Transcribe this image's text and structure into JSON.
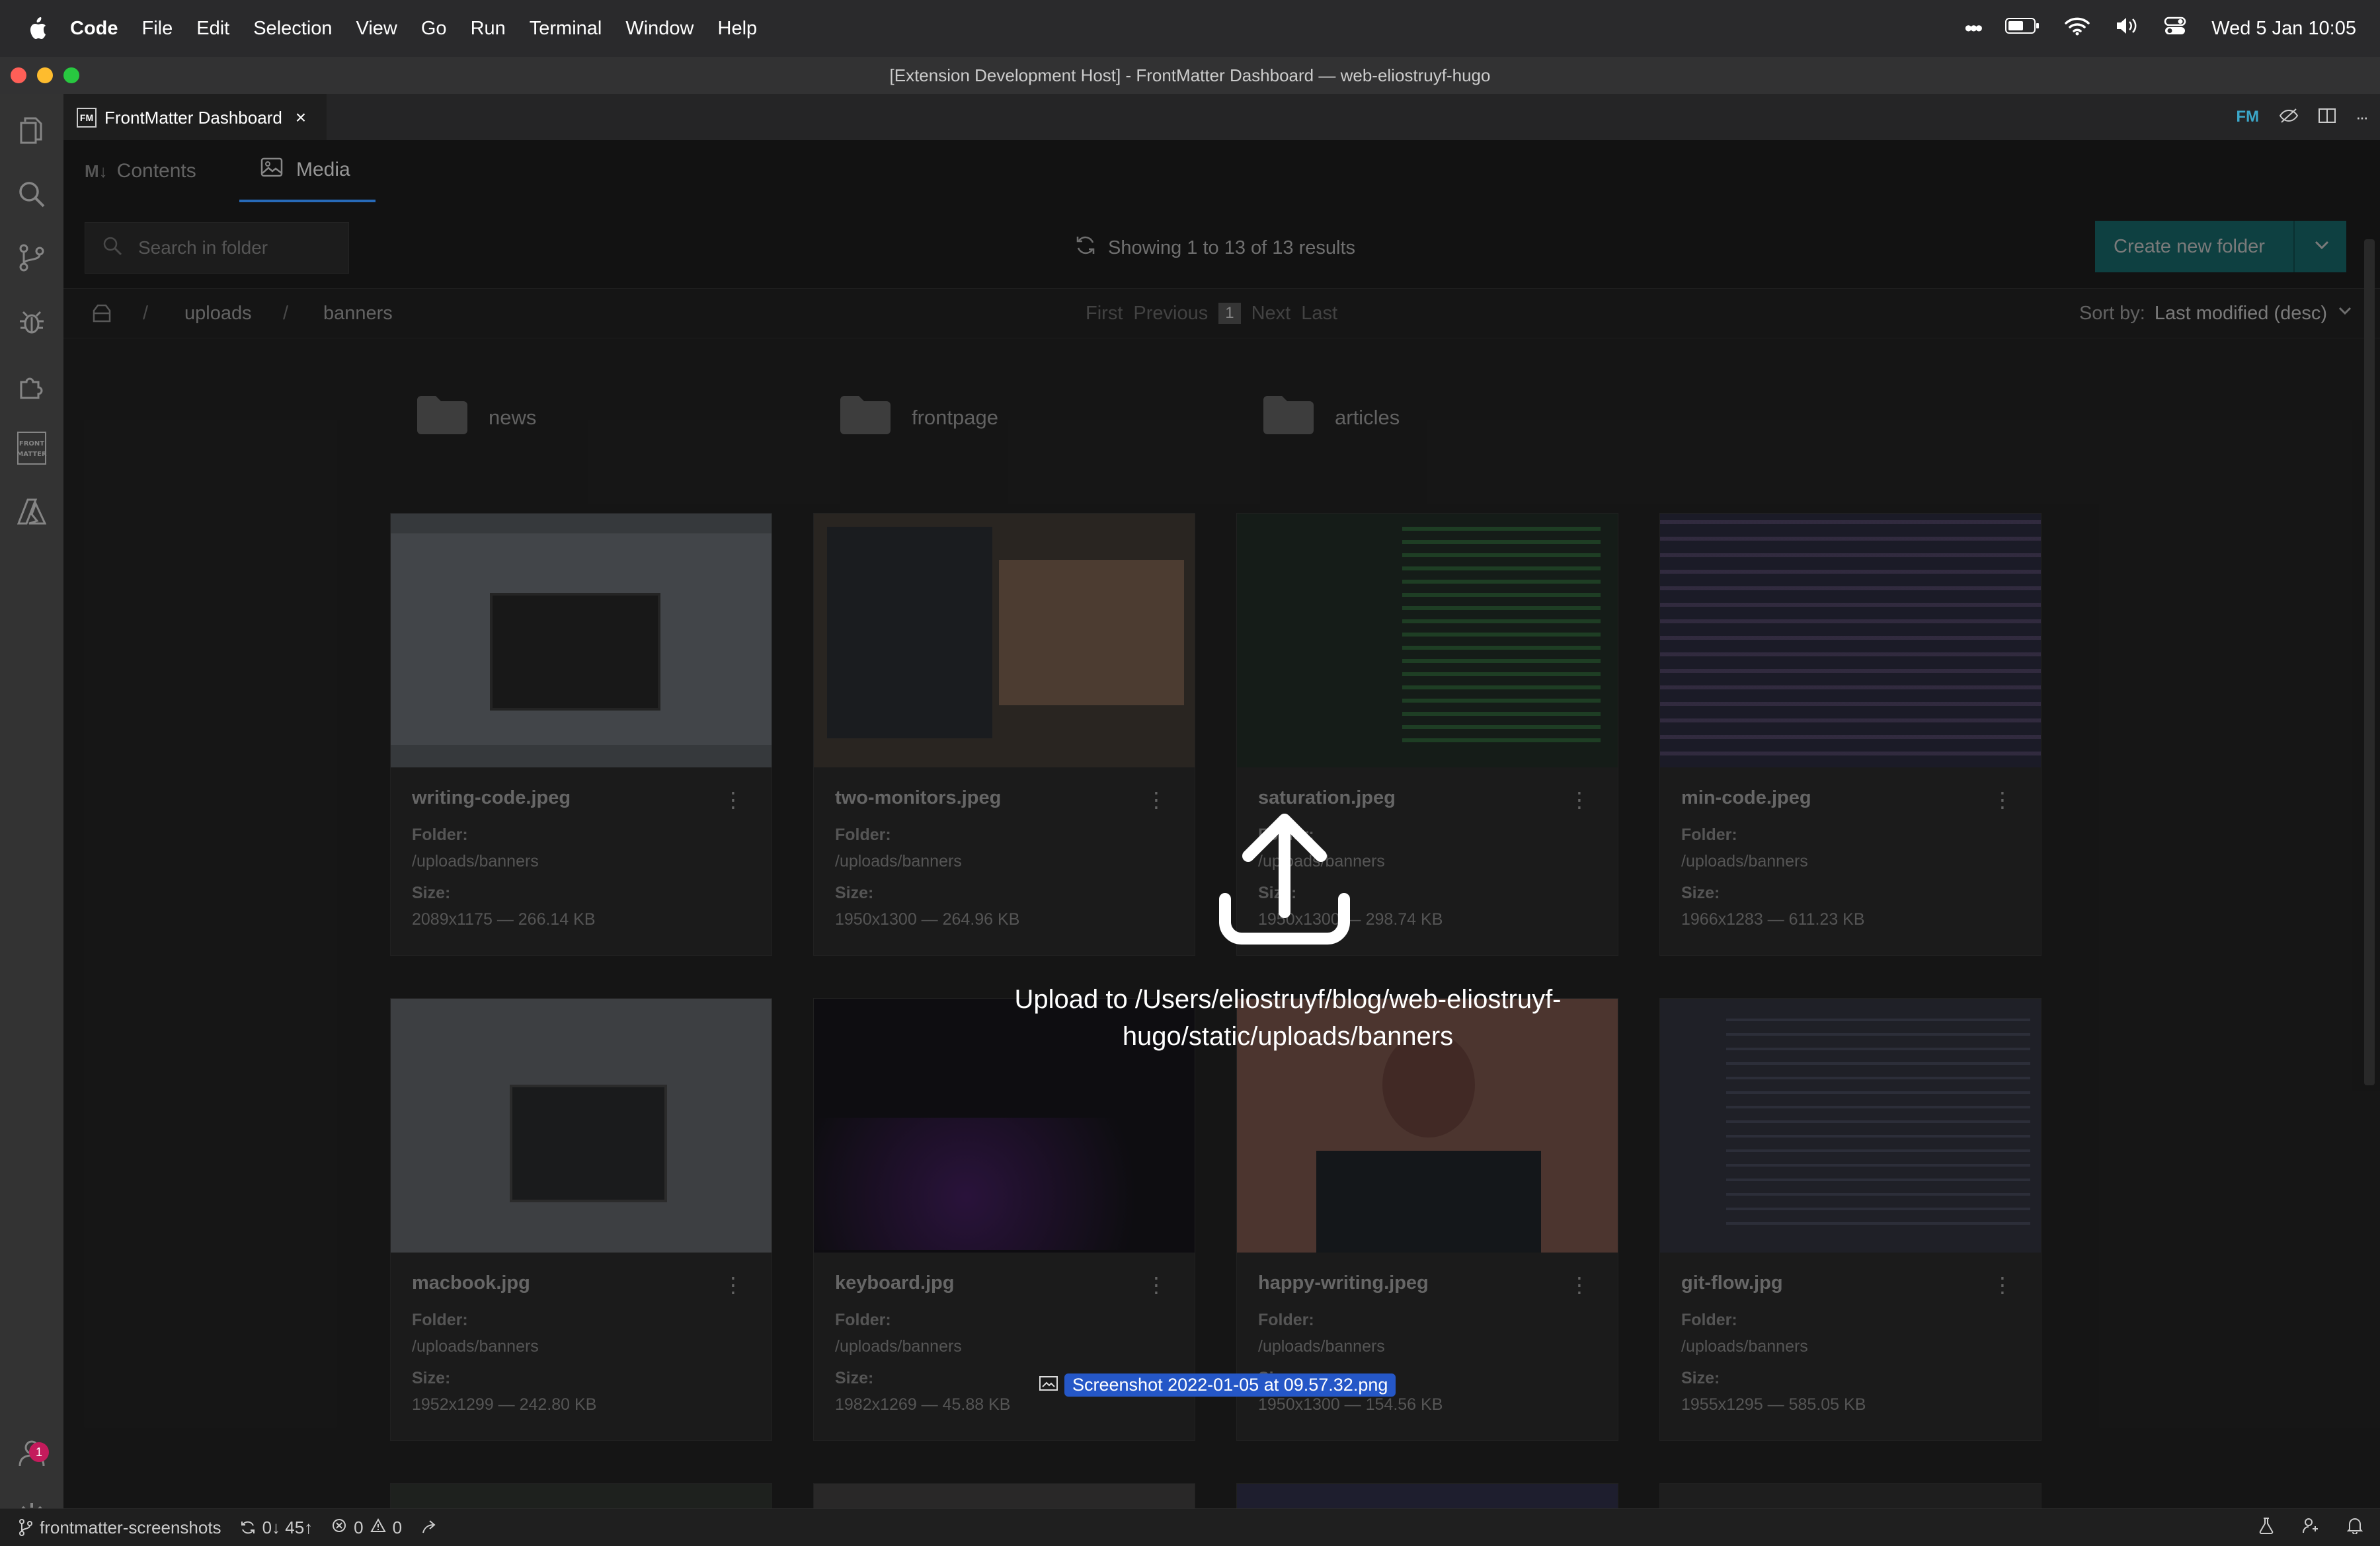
{
  "menubar": {
    "app": "Code",
    "items": [
      "File",
      "Edit",
      "Selection",
      "View",
      "Go",
      "Run",
      "Terminal",
      "Window",
      "Help"
    ],
    "clock": "Wed 5 Jan  10:05"
  },
  "window": {
    "title": "[Extension Development Host] - FrontMatter Dashboard — web-eliostruyf-hugo"
  },
  "tab": {
    "label": "FrontMatter Dashboard",
    "icon_text": "FM"
  },
  "dashboard": {
    "tabs": [
      {
        "label": "Contents",
        "icon": "markdown-icon"
      },
      {
        "label": "Media",
        "icon": "image-icon"
      }
    ],
    "search_placeholder": "Search in folder",
    "results_text": "Showing 1 to 13 of 13 results",
    "create_folder_label": "Create new folder",
    "breadcrumb": [
      "uploads",
      "banners"
    ],
    "pager": {
      "first": "First",
      "previous": "Previous",
      "current": "1",
      "next": "Next",
      "last": "Last"
    },
    "sort_label": "Sort by:",
    "sort_value": "Last modified (desc)",
    "folders": [
      "news",
      "frontpage",
      "articles"
    ],
    "folder_label": "Folder:",
    "size_label": "Size:",
    "media": [
      {
        "name": "writing-code.jpeg",
        "folder": "/uploads/banners",
        "size": "2089x1175 — 266.14 KB",
        "color": "#4c4f54"
      },
      {
        "name": "two-monitors.jpeg",
        "folder": "/uploads/banners",
        "size": "1950x1300 — 264.96 KB",
        "color": "#3a342f"
      },
      {
        "name": "saturation.jpeg",
        "folder": "/uploads/banners",
        "size": "1950x1300 — 298.74 KB",
        "color": "#1e2722"
      },
      {
        "name": "min-code.jpeg",
        "folder": "/uploads/banners",
        "size": "1966x1283 — 611.23 KB",
        "color": "#262636"
      },
      {
        "name": "macbook.jpg",
        "folder": "/uploads/banners",
        "size": "1952x1299 — 242.80 KB",
        "color": "#55585c"
      },
      {
        "name": "keyboard.jpg",
        "folder": "/uploads/banners",
        "size": "1982x1269 — 45.88 KB",
        "color": "#141318"
      },
      {
        "name": "happy-writing.jpeg",
        "folder": "/uploads/banners",
        "size": "1950x1300 — 154.56 KB",
        "color": "#6a4a42"
      },
      {
        "name": "git-flow.jpg",
        "folder": "/uploads/banners",
        "size": "1955x1295 — 585.05 KB",
        "color": "#2b2d36"
      }
    ],
    "upload_message": "Upload to /Users/eliostruyf/blog/web-eliostruyf-hugo/static/uploads/banners",
    "drag_file": "Screenshot 2022-01-05 at 09.57.32.png"
  },
  "statusbar": {
    "branch": "frontmatter-screenshots",
    "sync": "0↓ 45↑",
    "errors": "0",
    "warnings": "0"
  },
  "accounts_badge": "1",
  "colors": {
    "accent": "#3794ff",
    "button": "#14595a",
    "badge": "#c41b5c",
    "drag_chip": "#2557c7"
  }
}
